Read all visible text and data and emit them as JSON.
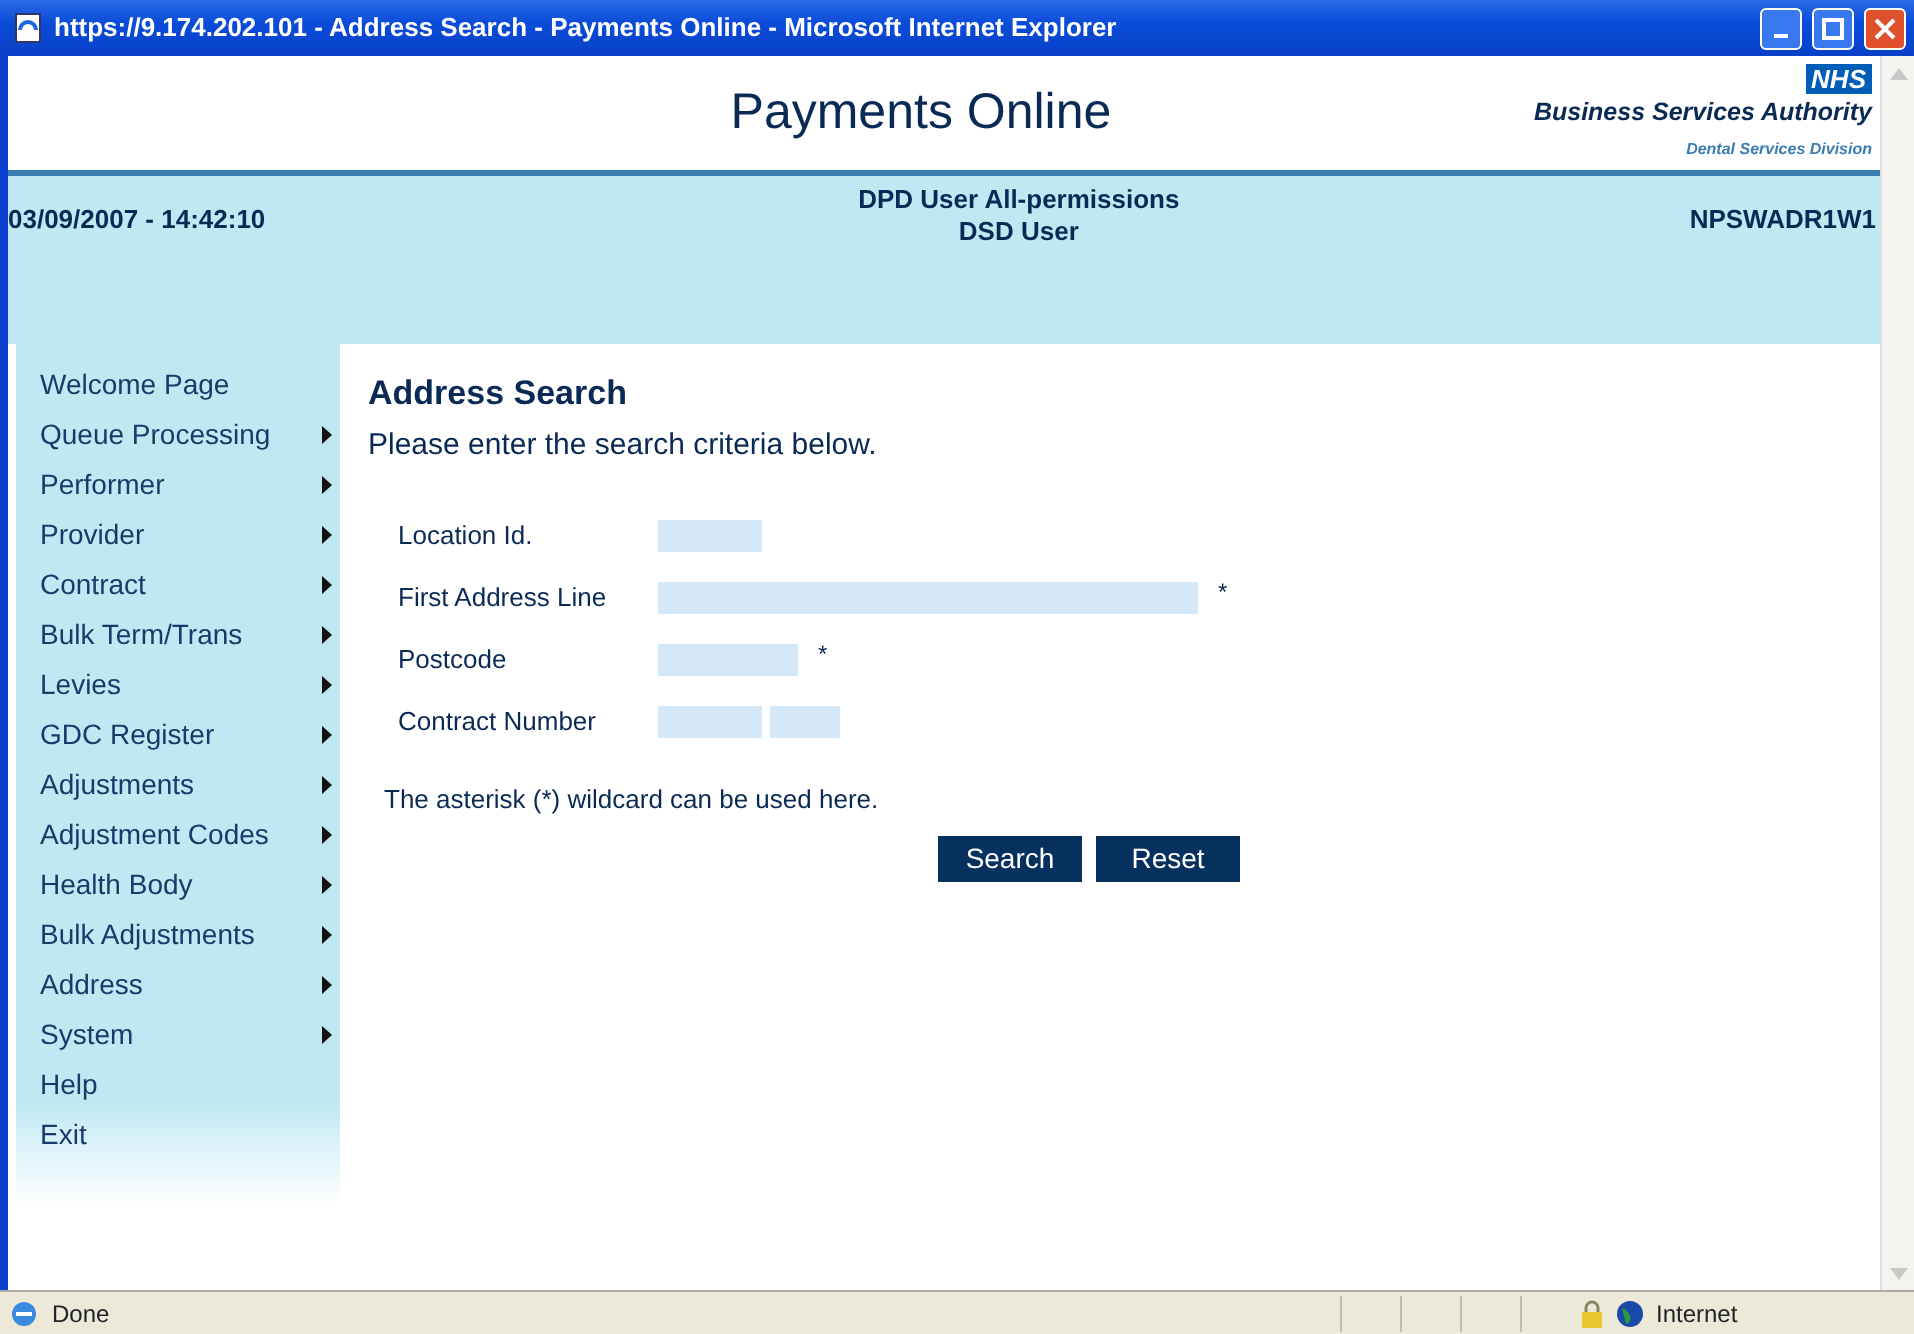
{
  "window": {
    "title": "https://9.174.202.101 - Address Search - Payments Online - Microsoft Internet Explorer"
  },
  "header": {
    "title": "Payments Online",
    "logo": {
      "badge": "NHS",
      "name": "Business Services Authority",
      "division": "Dental Services Division"
    }
  },
  "info_bar": {
    "datetime": "03/09/2007 - 14:42:10",
    "user_lines": [
      "DPD User All-permissions",
      "DSD User"
    ],
    "code": "NPSWADR1W1"
  },
  "sidebar": {
    "items": [
      {
        "label": "Welcome Page",
        "submenu": false
      },
      {
        "label": "Queue Processing",
        "submenu": true
      },
      {
        "label": "Performer",
        "submenu": true
      },
      {
        "label": "Provider",
        "submenu": true
      },
      {
        "label": "Contract",
        "submenu": true
      },
      {
        "label": "Bulk Term/Trans",
        "submenu": true
      },
      {
        "label": "Levies",
        "submenu": true
      },
      {
        "label": "GDC Register",
        "submenu": true
      },
      {
        "label": "Adjustments",
        "submenu": true
      },
      {
        "label": "Adjustment Codes",
        "submenu": true
      },
      {
        "label": "Health Body",
        "submenu": true
      },
      {
        "label": "Bulk Adjustments",
        "submenu": true
      },
      {
        "label": "Address",
        "submenu": true
      },
      {
        "label": "System",
        "submenu": true
      },
      {
        "label": "Help",
        "submenu": false
      },
      {
        "label": "Exit",
        "submenu": false
      }
    ]
  },
  "page": {
    "heading": "Address Search",
    "intro": "Please enter the search criteria below.",
    "fields": [
      {
        "label": "Location Id.",
        "kind": "short"
      },
      {
        "label": "First Address Line",
        "kind": "long",
        "required_mark": "*"
      },
      {
        "label": "Postcode",
        "kind": "medium",
        "required_mark": "*"
      },
      {
        "label": "Contract Number",
        "kind": "split"
      }
    ],
    "note": "The asterisk (*) wildcard can be used here.",
    "buttons": [
      "Search",
      "Reset"
    ]
  },
  "status_bar": {
    "text": "Done",
    "zone": "Internet"
  }
}
